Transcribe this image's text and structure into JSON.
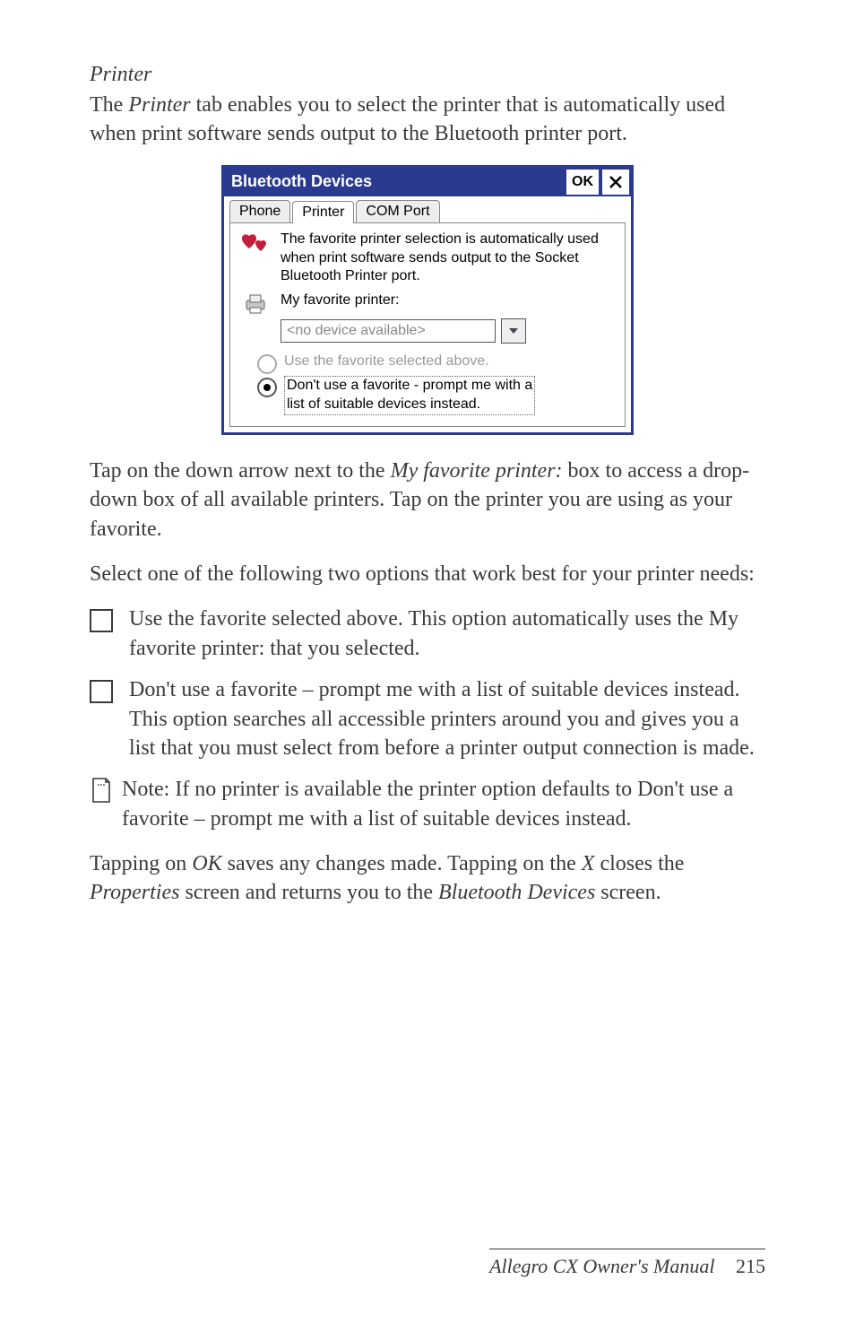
{
  "section_heading": "Printer",
  "intro_1a": "The ",
  "intro_1_em": "Printer",
  "intro_1b": " tab enables you to select the printer that is automatically used when print software sends output to the Bluetooth printer port.",
  "dialog": {
    "title": "Bluetooth Devices",
    "ok": "OK",
    "tabs": {
      "phone": "Phone",
      "printer": "Printer",
      "comport": "COM Port"
    },
    "desc": "The favorite printer selection is automatically used when print software sends output to the Socket Bluetooth Printer port.",
    "fav_label": "My favorite printer:",
    "combo_value": "<no device available>",
    "radio1": "Use the favorite selected above.",
    "radio2a": "Don't use a favorite - prompt me with a",
    "radio2b": "list of suitable devices instead."
  },
  "para2a": "Tap on the down arrow next to the ",
  "para2_em": "My favorite printer:",
  "para2b": " box to access a drop-down box of all available printers. Tap on the printer you are using as your favorite.",
  "para3": "Select one of the following two options that work best for your printer needs:",
  "bullets": [
    "Use the favorite selected above. This option automatically uses the My favorite printer: that you selected.",
    "Don't use a favorite – prompt me with a list of suitable devices instead. This option searches all accessible printers around you and gives you a list that you must select from before a printer output connection is made."
  ],
  "note": "Note: If no printer is available the printer option defaults to Don't use a favorite – prompt me with a list of suitable devices instead.",
  "para4a": "Tapping on ",
  "para4_em1": "OK",
  "para4b": " saves any changes made. Tapping on the ",
  "para4_em2": "X",
  "para4c": " closes the ",
  "para4_em3": "Properties",
  "para4d": " screen and returns you to the ",
  "para4_em4": "Bluetooth Devices",
  "para4e": " screen.",
  "footer_title": "Allegro CX Owner's Manual",
  "footer_page": "215"
}
